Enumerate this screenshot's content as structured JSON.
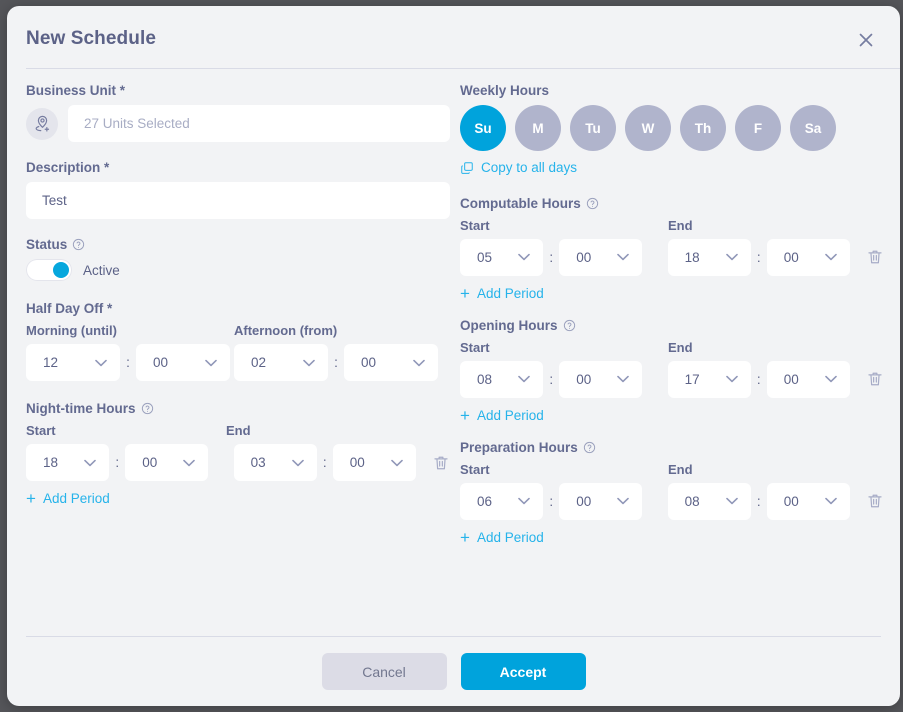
{
  "window": {
    "title": "New Schedule",
    "close_icon": "close-icon"
  },
  "colors": {
    "accent": "#00a3dc",
    "accent_link": "#26b3ea",
    "label": "#636a90",
    "inactive_day": "#b0b4cc",
    "panel_bg": "#f2f3f5",
    "cancel_bg": "#dcdce6"
  },
  "left": {
    "business_unit": {
      "label": "Business Unit *",
      "icon": "location-pin-add-icon",
      "placeholder": "27 Units Selected",
      "value": ""
    },
    "description": {
      "label": "Description *",
      "value": "Test"
    },
    "status": {
      "label": "Status",
      "help_icon": "question-circle-icon",
      "toggle_state": "on",
      "text": "Active"
    },
    "half_day_off": {
      "label": "Half Day Off *",
      "morning_label": "Morning (until)",
      "afternoon_label": "Afternoon (from)",
      "morning_hour": "12",
      "morning_minute": "00",
      "afternoon_hour": "02",
      "afternoon_minute": "00",
      "separator": ":"
    },
    "night_time_hours": {
      "label": "Night-time Hours",
      "help_icon": "question-circle-icon",
      "start_label": "Start",
      "end_label": "End",
      "start_hour": "18",
      "start_minute": "00",
      "end_hour": "03",
      "end_minute": "00",
      "separator": ":",
      "delete_icon": "trash-icon",
      "add_period": "Add Period"
    }
  },
  "right": {
    "weekly_hours": {
      "label": "Weekly Hours",
      "days": [
        {
          "label": "Su",
          "active": true
        },
        {
          "label": "M",
          "active": false
        },
        {
          "label": "Tu",
          "active": false
        },
        {
          "label": "W",
          "active": false
        },
        {
          "label": "Th",
          "active": false
        },
        {
          "label": "F",
          "active": false
        },
        {
          "label": "Sa",
          "active": false
        }
      ],
      "copy_label": "Copy to all days",
      "copy_icon": "copy-icon"
    },
    "computable_hours": {
      "label": "Computable Hours",
      "help_icon": "question-circle-icon",
      "start_label": "Start",
      "end_label": "End",
      "start_hour": "05",
      "start_minute": "00",
      "end_hour": "18",
      "end_minute": "00",
      "separator": ":",
      "delete_icon": "trash-icon",
      "add_period": "Add Period"
    },
    "opening_hours": {
      "label": "Opening Hours",
      "help_icon": "question-circle-icon",
      "start_label": "Start",
      "end_label": "End",
      "start_hour": "08",
      "start_minute": "00",
      "end_hour": "17",
      "end_minute": "00",
      "separator": ":",
      "delete_icon": "trash-icon",
      "add_period": "Add Period"
    },
    "preparation_hours": {
      "label": "Preparation Hours",
      "help_icon": "question-circle-icon",
      "start_label": "Start",
      "end_label": "End",
      "start_hour": "06",
      "start_minute": "00",
      "end_hour": "08",
      "end_minute": "00",
      "separator": ":",
      "delete_icon": "trash-icon",
      "add_period": "Add Period"
    }
  },
  "footer": {
    "cancel_label": "Cancel",
    "accept_label": "Accept"
  }
}
